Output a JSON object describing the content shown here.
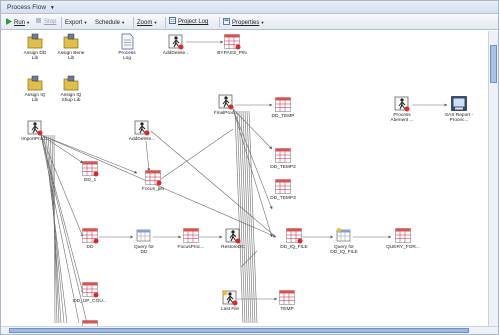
{
  "window": {
    "title": "Process Flow"
  },
  "toolbar": {
    "run": "Run",
    "stop": "Stop",
    "export": "Export",
    "schedule": "Schedule",
    "zoom": "Zoom",
    "project_log": "Project Log",
    "properties": "Properties"
  },
  "nodes": {
    "assign_dd_lib": "Assign DD Lib",
    "assign_bene_lib": "Assign Bene Lib",
    "process_log": "Process Log",
    "add_delete_1": "AddDelete...",
    "bypass_pin": "BYPASS_PIN",
    "assign_iq_lib": "Assign IQ Lib",
    "assign_iq_shup_lib": "Assign IQ Shup Lib",
    "final_proc": "FinalProc...",
    "dd_temp": "DD_TEMP",
    "process_abend": "Process Abenent ...",
    "sas_report": "SAS Report - Procec...",
    "import_proc": "ImportProc...",
    "add_delete_2": "AddDelete...",
    "dd_temp2": "DD_TEMP2",
    "dd_1": "DD_1",
    "focus_pin": "Focus_pin",
    "dd_temp3": "DD_TEMP3",
    "dd": "DD",
    "query_for_dd": "Query for DD",
    "focus_proc": "FocusProc...",
    "restore_dc": "RestoreDC",
    "dd_iq_file": "DD_IQ_FILE",
    "query_for_dd_iq_file": "Query for DD_IQ_FILE",
    "query_for_dots": "QUERY_FOR...",
    "dd_up_cou": "DD_UP_COU...",
    "last_file": "Last File",
    "temp": "TEMP"
  }
}
